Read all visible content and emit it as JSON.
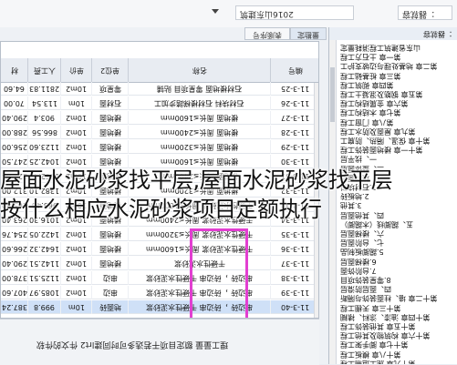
{
  "topbar": {
    "crumb_left": "2016山东建筑",
    "crumb_right": "：器就容"
  },
  "tabs": [
    {
      "label": "表顺序号"
    },
    {
      "label": "量勘定"
    }
  ],
  "columns": [
    {
      "label": "编号"
    },
    {
      "label": "名称"
    },
    {
      "label": "单位2"
    },
    {
      "label": "单价"
    },
    {
      "label": "人工费"
    },
    {
      "label": "材"
    }
  ],
  "rows": [
    {
      "code": "11-3-25",
      "name": "石材楼地面 零星项目 贴铺",
      "unit2": "零星项",
      "unit": "10m2",
      "price": "2811.83",
      "labor": "64.60",
      "sel": false
    },
    {
      "code": "11-3-26",
      "name": "石材块料 石材楼梯踏步加工",
      "unit2": "石材面",
      "unit": "10m",
      "price": "113.54",
      "labor": "70.00",
      "sel": false
    },
    {
      "code": "11-3-27",
      "name": "楼地面 周长≤1600mm",
      "unit2": "楼地面",
      "unit": "10m2",
      "price": "903.4",
      "labor": "290.40",
      "sel": false
    },
    {
      "code": "11-3-28",
      "name": "楼地面 周长≤2400mm",
      "unit2": "楼地面",
      "unit": "10m2",
      "price": "866.56",
      "labor": "288.00",
      "sel": false
    },
    {
      "code": "11-3-29",
      "name": "楼地面 周长≤3200mm",
      "unit2": "楼地面",
      "unit": "10m2",
      "price": "1123.60",
      "labor": "256.00",
      "sel": false
    },
    {
      "code": "11-3-30",
      "name": "楼地面 周长≤1600mm",
      "unit2": "楼地面",
      "unit": "10m2",
      "price": "1042.25",
      "labor": "247.50",
      "sel": false
    },
    {
      "code": "11-3-31",
      "name": "楼地面 周长≤2400mm",
      "unit2": "楼地面",
      "unit": "10m2",
      "price": "1262.45",
      "labor": "221.84",
      "sel": false
    },
    {
      "code": "11-3-32",
      "name": "楼地面 周长≤3200mm",
      "unit2": "楼地面",
      "unit": "10m2",
      "price": "1382.10",
      "labor": "312.00",
      "sel": false
    },
    {
      "code": "11-3-33",
      "name": "干硬性水泥砂浆 周长≤1600mm",
      "unit2": "楼地面",
      "unit": "10m2",
      "price": "963.46",
      "labor": "265.80",
      "sel": false
    },
    {
      "code": "11-3-34",
      "name": "干硬性水泥砂浆 周长≤2400mm",
      "unit2": "楼地面",
      "unit": "10m2",
      "price": "1016.30",
      "labor": "263.40",
      "sel": false
    },
    {
      "code": "11-3-35",
      "name": "干硬性水泥砂浆 周长≤3200mm",
      "unit2": "楼地面",
      "unit": "10m2",
      "price": "1422.05",
      "labor": "254.76",
      "sel": false
    },
    {
      "code": "11-3-36",
      "name": "干硬性水泥砂浆 周长≤1600mm",
      "unit2": "楼地面",
      "unit": "10m2",
      "price": "1642.32",
      "labor": "266.60",
      "sel": false
    },
    {
      "code": "11-3-37",
      "name": "干硬性水泥砂浆",
      "unit2": "楼地面",
      "unit": "10m2",
      "price": "1142.51",
      "labor": "290.40",
      "sel": false
    },
    {
      "code": "11-3-38",
      "name": "串边砖 ，砖边串 干硬性水泥砂浆",
      "unit2": "串边",
      "unit": "10m2",
      "price": "1125.51",
      "labor": "378.00",
      "sel": false
    },
    {
      "code": "11-3-39",
      "name": "串边砖 ，砖边串 干硬性水泥砂浆",
      "unit2": "串边",
      "unit": "10m2",
      "price": "1085.97",
      "labor": "407.60",
      "sel": false
    },
    {
      "code": "11-3-40",
      "name": "串边砖 ，砖边串 干硬性水泥砂浆",
      "unit2": "地面砖",
      "unit": "10m",
      "price": "999.8",
      "labor": "387.24",
      "sel": true
    }
  ],
  "status": {
    "text": "理工量量 额定目项干若选多可时同建lrt2 件文的件软"
  },
  "tree": {
    "title": "：器就容",
    "nodes": [
      "山东省建筑工程消耗量定",
      "第一章 土石方工程",
      "第二章 地基处理与边坡支护工",
      "第三章 桩基础工程",
      "第四章 砌筑工程",
      "第五章 钢筋及混凝土工程",
      "第六章 金属结构工程",
      "第七章 木结构工程",
      "第八章 门窗工程",
      "第九章 屋面及防水工程",
      "第十章 保温、隔热、防腐工",
      "第十一章 楼地面装饰工程",
      "一、找平层",
      "二、整体面层",
      "三、块料面层",
      "1.石材块料",
      "2.地板砖",
      "3.其他",
      "四、其他面层",
      "五、踢脚线（木踢脚）",
      "六、楼梯面层",
      "七、台阶面层",
      "5.踢脚板制品",
      "6.楼梯面层",
      "7.台阶饰面",
      "8.零星装饰项目",
      "四、面层防滑层",
      "第十二章 墙、柱面装饰与隔断",
      "第十三章 天棚工程",
      "第十四章 油漆、涂料、裱糊",
      "第十五章 其他装饰工程",
      "第十六章 构筑物及其他工程",
      "第十七章 脚手架工程",
      "第十八章 模板工程",
      "第十九章 施工运输工程"
    ]
  },
  "headline": {
    "line1": "屋面水泥砂浆找平层,屋面水泥砂浆找平层",
    "line2": "按什么相应水泥砂浆项目定额执行"
  }
}
